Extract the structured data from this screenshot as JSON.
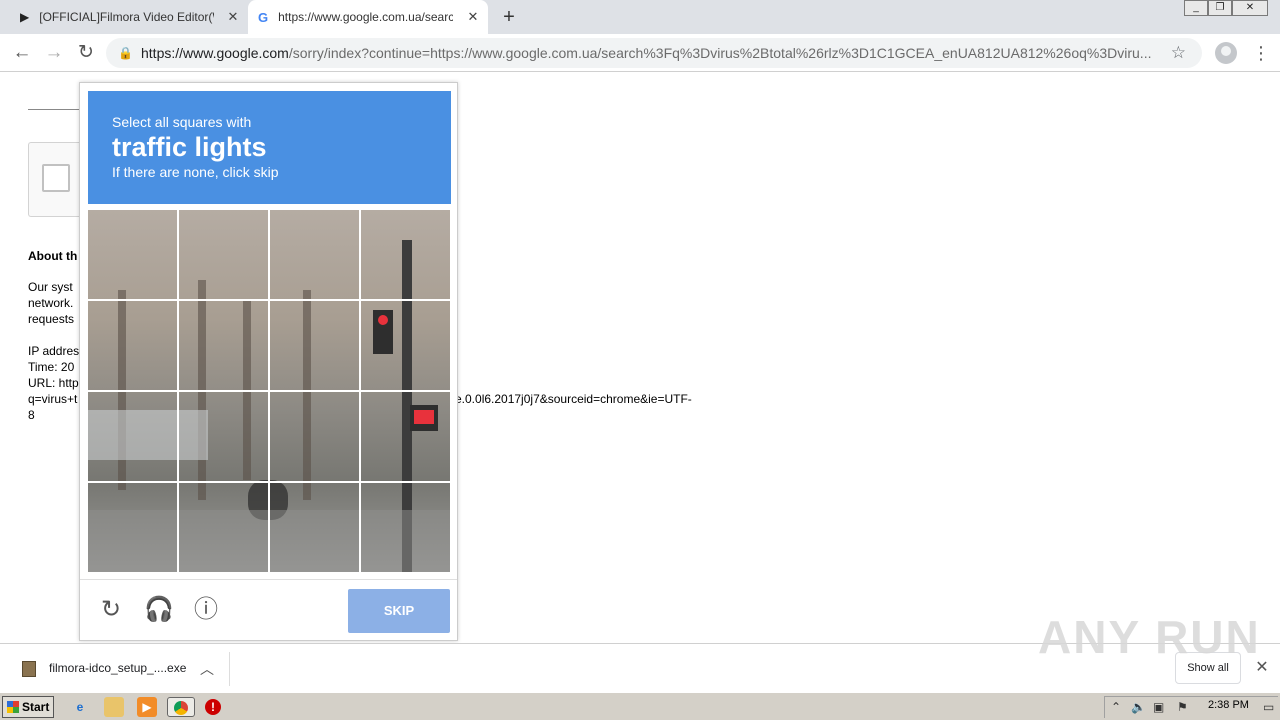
{
  "tabs": [
    {
      "title": "[OFFICIAL]Filmora Video Editor(Windows)",
      "favicon": "filmora-icon"
    },
    {
      "title": "https://www.google.com.ua/search?q=virus",
      "favicon": "google-icon"
    }
  ],
  "window_controls": {
    "minimize": "_",
    "restore": "❐",
    "close": "✕"
  },
  "toolbar": {
    "url_host": "https://www.google.com",
    "url_rest": "/sorry/index?continue=https://www.google.com.ua/search%3Fq%3Dvirus%2Btotal%26rlz%3D1C1GCEA_enUA812UA812%26oq%3Dviru..."
  },
  "page": {
    "about_heading": "About th",
    "para_lines": [
      "Our syst",
      "network.",
      "requests"
    ],
    "ip_label": "IP addres",
    "time_label": "Time: 20",
    "url_label": "URL: http",
    "query_start": "q=virus+t",
    "query_end": "e.0.0l6.2017j0j7&sourceid=chrome&ie=UTF-",
    "query_wrap": "8"
  },
  "captcha": {
    "instruction": "Select all squares with",
    "target": "traffic lights",
    "hint": "If there are none, click skip",
    "skip_label": "SKIP",
    "icons": [
      "reload-icon",
      "audio-icon",
      "info-icon"
    ],
    "grid_size": 4
  },
  "download": {
    "filename": "filmora-idco_setup_....exe",
    "show_all": "Show all"
  },
  "watermark": "ANY RUN",
  "taskbar": {
    "start_label": "Start",
    "clock": "2:38 PM"
  }
}
